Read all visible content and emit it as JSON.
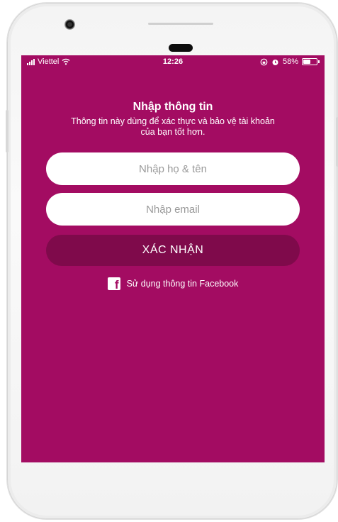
{
  "status_bar": {
    "carrier": "Viettel",
    "time": "12:26",
    "battery_percent": "58%",
    "battery_level": 0.58,
    "icons": [
      "signal-icon",
      "wifi-icon",
      "orientation-lock-icon",
      "alarm-icon",
      "battery-icon"
    ]
  },
  "form": {
    "title": "Nhập thông tin",
    "subtitle": "Thông tin này dùng để xác thực và bảo vệ tài khoản của bạn tốt hơn.",
    "name_placeholder": "Nhập họ & tên",
    "name_value": "",
    "email_placeholder": "Nhập email",
    "email_value": "",
    "submit_label": "XÁC NHẬN",
    "facebook_label": "Sử dụng thông tin Facebook"
  },
  "colors": {
    "screen_background": "#a30c62",
    "submit_button": "#7f0a4b",
    "input_background": "#ffffff",
    "text": "#ffffff"
  }
}
